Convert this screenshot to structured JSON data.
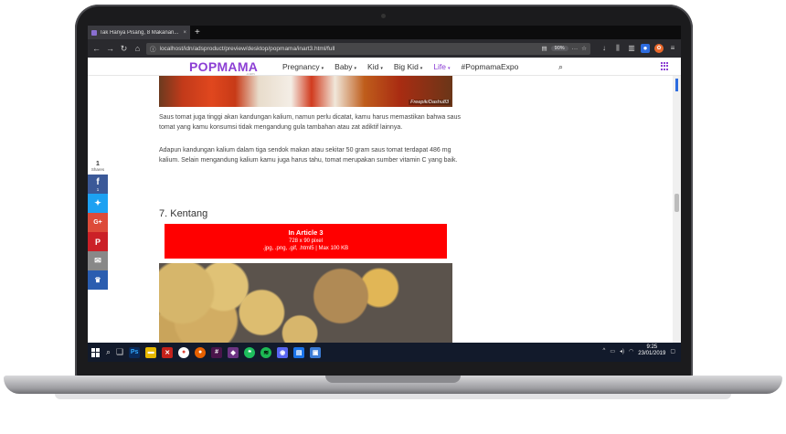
{
  "browser": {
    "tab_title": "Tak Hanya Pisang, 8 Makanan...",
    "tab_close": "×",
    "new_tab": "+",
    "url": "localhost/idn/adsproduct/preview/desktop/popmama/inart3.html/full",
    "zoom": "90%"
  },
  "site": {
    "logo": "POPMAMA",
    "logo_sub": ".com",
    "menu": [
      {
        "label": "Pregnancy",
        "caret": "▾"
      },
      {
        "label": "Baby",
        "caret": "▾"
      },
      {
        "label": "Kid",
        "caret": "▾"
      },
      {
        "label": "Big Kid",
        "caret": "▾"
      },
      {
        "label": "Life",
        "caret": "▾"
      },
      {
        "label": "#PopmamaExpo",
        "caret": ""
      }
    ],
    "accent": "#8c3fd4"
  },
  "article": {
    "image_caption": "Freepik/Dashu83",
    "para1": "Saus tomat juga tinggi akan kandungan kalium, namun perlu dicatat, kamu harus memastikan bahwa saus tomat yang kamu konsumsi tidak mengandung gula tambahan atau zat adiktif lainnya.",
    "para2": "Adapun kandungan kalium dalam  tiga sendok makan atau sekitar 50 gram saus tomat terdapat 486 mg kalium. Selain mengandung kalium kamu juga harus tahu, tomat merupakan sumber vitamin C yang baik.",
    "heading": "7. Kentang",
    "ad": {
      "title": "In Article 3",
      "size": "728 x 90 pixel",
      "formats": ".jpg, .png, .gif, .html5 | Max 100 KB",
      "color": "#ff0000"
    }
  },
  "share": {
    "count": "1",
    "label": "Shares",
    "fb_count": "1",
    "buttons": [
      "facebook-icon",
      "twitter-icon",
      "google-plus-icon",
      "pinterest-icon",
      "email-icon",
      "sumo-icon"
    ]
  },
  "taskbar": {
    "time": "9:25",
    "date": "23/01/2019"
  }
}
